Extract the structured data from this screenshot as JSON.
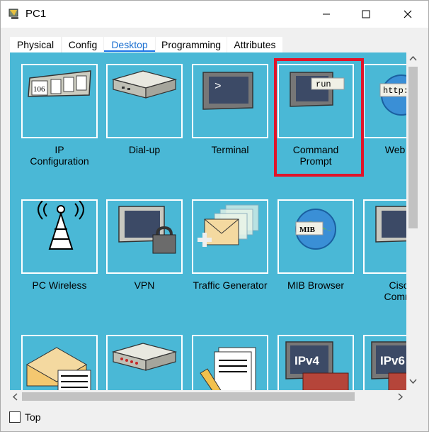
{
  "window": {
    "title": "PC1"
  },
  "tabs": [
    {
      "label": "Physical"
    },
    {
      "label": "Config"
    },
    {
      "label": "Desktop"
    },
    {
      "label": "Programming"
    },
    {
      "label": "Attributes"
    }
  ],
  "active_tab": "Desktop",
  "apps": [
    {
      "label": "IP\nConfiguration",
      "icon": "ip-config-icon",
      "text": "106"
    },
    {
      "label": "Dial-up",
      "icon": "dialup-modem-icon"
    },
    {
      "label": "Terminal",
      "icon": "terminal-icon",
      "text": ">"
    },
    {
      "label": "Command\nPrompt",
      "icon": "command-prompt-icon",
      "text": "run"
    },
    {
      "label": "Web Br",
      "icon": "web-browser-icon",
      "text": "http:"
    },
    {
      "label": "PC Wireless",
      "icon": "wireless-antenna-icon"
    },
    {
      "label": "VPN",
      "icon": "vpn-lock-icon"
    },
    {
      "label": "Traffic Generator",
      "icon": "traffic-generator-icon"
    },
    {
      "label": "MIB Browser",
      "icon": "mib-browser-icon",
      "text": "MIB"
    },
    {
      "label": "Cisco\nCommu",
      "icon": "cisco-communicator-icon"
    },
    {
      "label": "",
      "icon": "email-icon"
    },
    {
      "label": "",
      "icon": "pppoe-dialer-icon"
    },
    {
      "label": "",
      "icon": "text-editor-icon"
    },
    {
      "label": "",
      "icon": "ipv4-firewall-icon",
      "text": "IPv4"
    },
    {
      "label": "",
      "icon": "ipv6-firewall-icon",
      "text": "IPv6"
    }
  ],
  "footer": {
    "top_label": "Top"
  },
  "colors": {
    "desktop_bg": "#4ab8d6",
    "highlight": "#e0142a",
    "active_tab": "#1a73e8"
  }
}
